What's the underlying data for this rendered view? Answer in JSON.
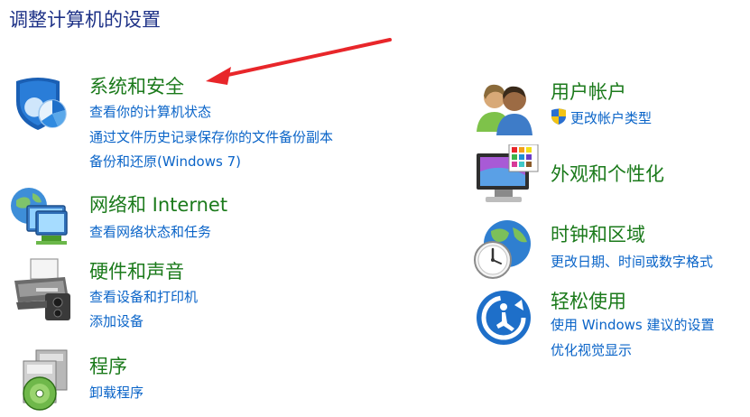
{
  "page_title": "调整计算机的设置",
  "left_categories": {
    "system_security": {
      "icon": "security-shield-icon",
      "title": "系统和安全",
      "links": [
        "查看你的计算机状态",
        "通过文件历史记录保存你的文件备份副本",
        "备份和还原(Windows 7)"
      ]
    },
    "network": {
      "icon": "network-globe-icon",
      "title": "网络和 Internet",
      "links": [
        "查看网络状态和任务"
      ]
    },
    "hardware": {
      "icon": "printer-hardware-icon",
      "title": "硬件和声音",
      "links": [
        "查看设备和打印机",
        "添加设备"
      ]
    },
    "programs": {
      "icon": "programs-disc-icon",
      "title": "程序",
      "links": [
        "卸载程序"
      ]
    }
  },
  "right_categories": {
    "user_accounts": {
      "icon": "users-icon",
      "title": "用户帐户",
      "links": [
        "更改帐户类型"
      ]
    },
    "appearance": {
      "icon": "monitor-palette-icon",
      "title": "外观和个性化",
      "links": []
    },
    "clock_region": {
      "icon": "clock-globe-icon",
      "title": "时钟和区域",
      "links": [
        "更改日期、时间或数字格式"
      ]
    },
    "ease_access": {
      "icon": "ease-of-access-icon",
      "title": "轻松使用",
      "links": [
        "使用 Windows 建议的设置",
        "优化视觉显示"
      ]
    }
  },
  "colors": {
    "title": "#1e3287",
    "category": "#1b7a1b",
    "link": "#0a64c8",
    "annotation_arrow": "#e8262a"
  }
}
